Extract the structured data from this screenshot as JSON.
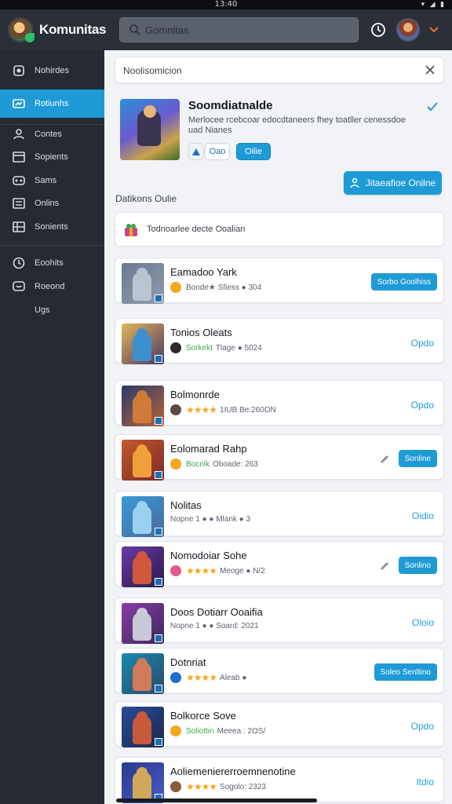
{
  "status_bar": {
    "time": "13:40",
    "icons": "▾ ◢ ▮"
  },
  "header": {
    "app_title": "Komunitas",
    "search_placeholder": "Gomnitas",
    "logo_icon": "app-logo",
    "avatar_icon": "user-avatar"
  },
  "sidebar": {
    "items": [
      {
        "label": "Nohirdes",
        "icon": "home-icon",
        "active": false
      },
      {
        "label": "Rotiunhs",
        "icon": "community-icon",
        "active": true
      },
      {
        "label": "Contes",
        "icon": "person-icon",
        "active": false
      },
      {
        "label": "Sopients",
        "icon": "list-icon",
        "active": false
      },
      {
        "label": "Sams",
        "icon": "games-icon",
        "active": false
      },
      {
        "label": "Onlins",
        "icon": "menu-icon",
        "active": false
      },
      {
        "label": "Sonients",
        "icon": "table-icon",
        "active": false
      },
      {
        "label": "Eoohits",
        "icon": "clock-icon",
        "active": false
      },
      {
        "label": "Roeond",
        "icon": "message-icon",
        "active": false
      },
      {
        "label": "Ugs",
        "icon": "",
        "active": false
      }
    ]
  },
  "main": {
    "notification": {
      "text": "Noolisomicion"
    },
    "featured": {
      "title": "Soomdiatnalde",
      "description": "Merlocee rcebcoar edocdtaneers fhey toatller cenessdoe uad Nianes",
      "chip_small": "Oao",
      "chip_button": "Oilie"
    },
    "primary_button": "Jitaeafioe Onilne",
    "section_title": "Datikons Oulie",
    "sub_card_text": "Todnoarlee decte Ooalian",
    "rows": [
      {
        "name": "Eamadoo Yark",
        "tag": "",
        "stars": "",
        "meta": "Bonde★ Sfiess ● 304",
        "action": "Sorbo Goolhiss",
        "action_type": "button",
        "pen": false,
        "coin": "#f2a81d",
        "palette": [
          "#6b7a8f",
          "#b8c4d2",
          "#8f9caf"
        ]
      },
      {
        "name": "Tonios Oleats",
        "tag": "Sorkekt",
        "stars": "",
        "meta": "Tlage ● 5024",
        "action": "Opdo",
        "action_type": "text",
        "pen": false,
        "coin": "#2a2a2a",
        "palette": [
          "#e2b45a",
          "#3e8fd0",
          "#4a3a62"
        ]
      },
      {
        "name": "Bolmonrde",
        "tag": "",
        "stars": "★★★★",
        "meta": "1IUB Be:260ON",
        "action": "Opdo",
        "action_type": "text",
        "pen": false,
        "coin": "#5a4a4a",
        "palette": [
          "#2a3a6a",
          "#d07a3a",
          "#b8643a"
        ]
      },
      {
        "name": "Eolomarad Rahp",
        "tag": "Bocnik",
        "stars": "",
        "meta": "Oboade: 263",
        "action": "Sonline",
        "action_type": "button",
        "pen": true,
        "coin": "#f2a81d",
        "palette": [
          "#c25a2a",
          "#f0a03a",
          "#7a2a2a"
        ]
      },
      {
        "name": "Nolitas",
        "tag": "",
        "stars": "",
        "meta": "Nopne 1 ● ● Mlank ● 3",
        "action": "Oidio",
        "action_type": "text",
        "pen": false,
        "coin": "",
        "palette": [
          "#3a9ad8",
          "#9ad0f0",
          "#4a6a9a"
        ]
      },
      {
        "name": "Nomodoiar Sohe",
        "tag": "",
        "stars": "★★★★",
        "meta": "Meoge ● N/2",
        "action": "Sonlino",
        "action_type": "button",
        "pen": true,
        "coin": "#e25a8a",
        "palette": [
          "#6a3aa8",
          "#d0583a",
          "#2a1a4a"
        ]
      },
      {
        "name": "Doos Dotiarr Ooaifia",
        "tag": "",
        "stars": "",
        "meta": "Nopne 1 ● ● Soard: 2021",
        "action": "Oloio",
        "action_type": "text",
        "pen": false,
        "coin": "",
        "palette": [
          "#8a3aa8",
          "#c8c8d8",
          "#3a2a5a"
        ]
      },
      {
        "name": "Dotnriat",
        "tag": "",
        "stars": "★★★★",
        "meta": "Aleab ●",
        "action": "Soleo Senltino",
        "action_type": "button",
        "pen": false,
        "coin": "#1e6fc8",
        "palette": [
          "#1a8ab0",
          "#d07a5a",
          "#2a4a6a"
        ]
      },
      {
        "name": "Bolkorce Sove",
        "tag": "Soliottin",
        "stars": "",
        "meta": "Meeea : 2OS/",
        "action": "Opdo",
        "action_type": "text",
        "pen": false,
        "coin": "#f2a81d",
        "palette": [
          "#2a4a9a",
          "#c85a3a",
          "#1a2a4a"
        ]
      },
      {
        "name": "Aoliemeniererroemnenotine",
        "tag": "",
        "stars": "★★★★",
        "meta": "Sogolo: 2323",
        "action": "Itdio",
        "action_type": "text",
        "pen": false,
        "coin": "#8a5a3a",
        "palette": [
          "#2a3a8a",
          "#d0a85a",
          "#4a5ac8"
        ]
      }
    ]
  },
  "colors": {
    "accent": "#1e9ad7",
    "sidebar": "#252a33",
    "topbar": "#2a2f38",
    "star": "#f2a81d"
  }
}
